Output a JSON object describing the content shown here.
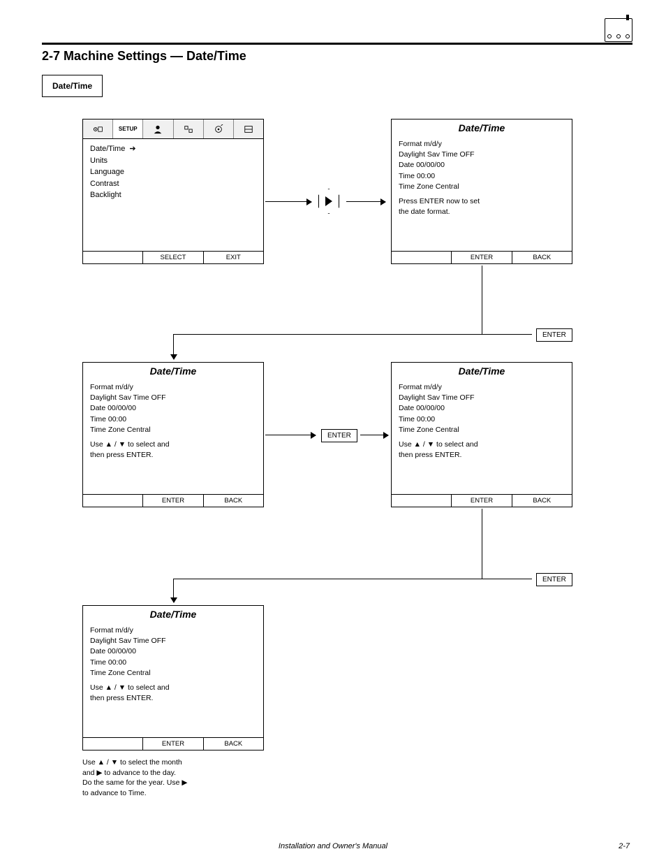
{
  "header": {
    "section_title": "2-7  Machine Settings — Date/Time"
  },
  "label_box": "Date/Time",
  "screen1": {
    "tab_setup": "SETUP",
    "menu": [
      "Date/Time",
      "Units",
      "Language",
      "Contrast",
      "Backlight"
    ],
    "highlight_prefix": "Date/Time",
    "foot_left": "",
    "foot_mid": "SELECT",
    "foot_right": "EXIT"
  },
  "screen2": {
    "title": "Date/Time",
    "l1": "Format     m/d/y",
    "l2": "Daylight Sav Time  OFF",
    "l3": "Date       00/00/00",
    "l4": "Time       00:00",
    "l5": "Time Zone  Central",
    "l6": "Press ENTER now to set",
    "l7": "the date format.",
    "foot_left": "",
    "foot_mid": "ENTER",
    "foot_right": "BACK"
  },
  "btn_enter1": "ENTER",
  "screen3": {
    "title": "Date/Time",
    "l1": "Format     m/d/y",
    "l2": "Daylight Sav Time  OFF",
    "l3": "Date       00/00/00",
    "l4": "Time       00:00",
    "l5": "Time Zone  Central",
    "l6": "Use   ▲ / ▼   to select and",
    "l7": "then press ENTER.",
    "foot_left": "",
    "foot_mid": "ENTER",
    "foot_right": "BACK"
  },
  "btn_enter2": "ENTER",
  "screen4": {
    "title": "Date/Time",
    "l1": "Format     m/d/y",
    "l2": "Daylight Sav Time  OFF",
    "l3": "Date       00/00/00",
    "l4": "Time       00:00",
    "l5": "Time Zone  Central",
    "l6": "Use   ▲ / ▼   to select and",
    "l7": "then press ENTER.",
    "foot_left": "",
    "foot_mid": "ENTER",
    "foot_right": "BACK"
  },
  "btn_enter3": "ENTER",
  "screen5": {
    "title": "Date/Time",
    "l1": "Format     m/d/y",
    "l2": "Daylight Sav Time  OFF",
    "l3": "Date       00/00/00",
    "l4": "Time       00:00",
    "l5": "Time Zone  Central",
    "l6": "Use   ▲ / ▼   to select and",
    "l7": "then press ENTER.",
    "foot_left": "",
    "foot_mid": "ENTER",
    "foot_right": "BACK"
  },
  "note": {
    "l1": "Use   ▲ / ▼   to select the month",
    "l2": "and   ▶   to advance to the day.",
    "l3": "Do the same for the year. Use   ▶",
    "l4": "to advance to Time."
  },
  "footer": {
    "center": "Installation and Owner's Manual",
    "right": "2-7"
  }
}
